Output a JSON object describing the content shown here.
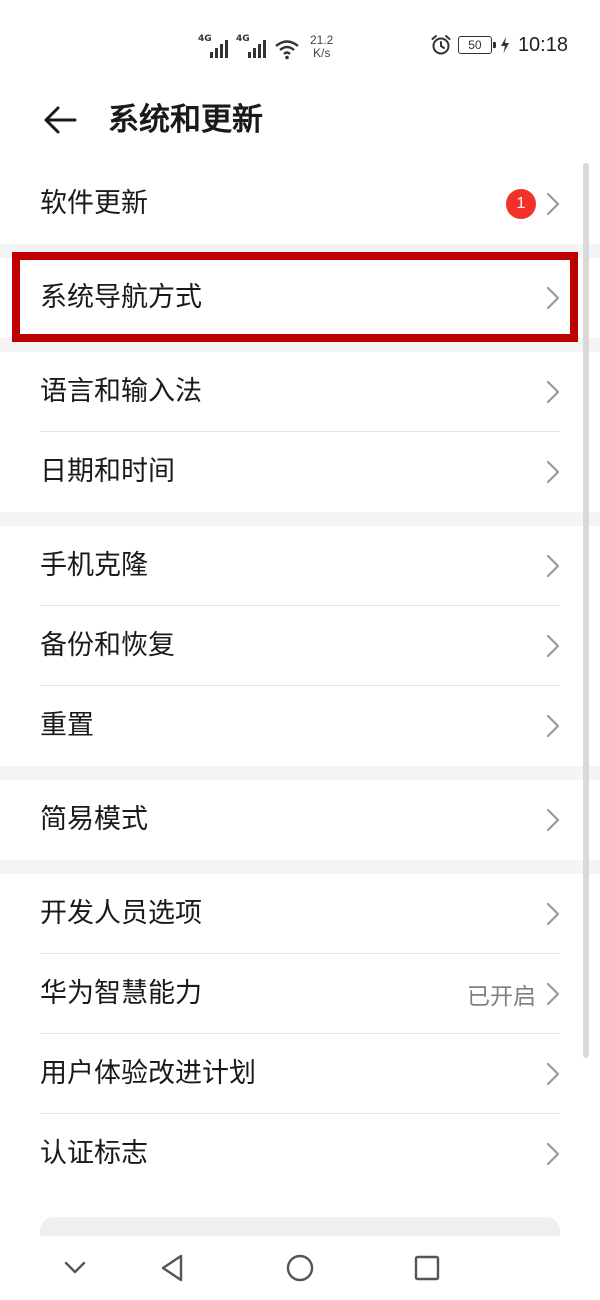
{
  "status_bar": {
    "signal1_tag": "4G",
    "signal2_tag": "4G",
    "net_speed_value": "21.2",
    "net_speed_unit": "K/s",
    "battery_level": "50",
    "time": "10:18"
  },
  "header": {
    "title": "系统和更新",
    "back_icon": "arrow-left-icon"
  },
  "groups": [
    {
      "items": [
        {
          "label": "软件更新",
          "badge": "1"
        }
      ]
    },
    {
      "items": [
        {
          "label": "系统导航方式"
        }
      ]
    },
    {
      "items": [
        {
          "label": "语言和输入法"
        },
        {
          "label": "日期和时间"
        }
      ]
    },
    {
      "items": [
        {
          "label": "手机克隆"
        },
        {
          "label": "备份和恢复"
        },
        {
          "label": "重置"
        }
      ]
    },
    {
      "items": [
        {
          "label": "简易模式"
        }
      ]
    },
    {
      "items": [
        {
          "label": "开发人员选项"
        },
        {
          "label": "华为智慧能力",
          "status": "已开启"
        },
        {
          "label": "用户体验改进计划"
        },
        {
          "label": "认证标志"
        }
      ]
    }
  ],
  "highlight_color": "#c00000",
  "badge_color": "#f2312b",
  "nav_bar": {
    "icons": [
      "chevron-down-icon",
      "back-triangle-icon",
      "home-circle-icon",
      "recents-square-icon"
    ]
  }
}
